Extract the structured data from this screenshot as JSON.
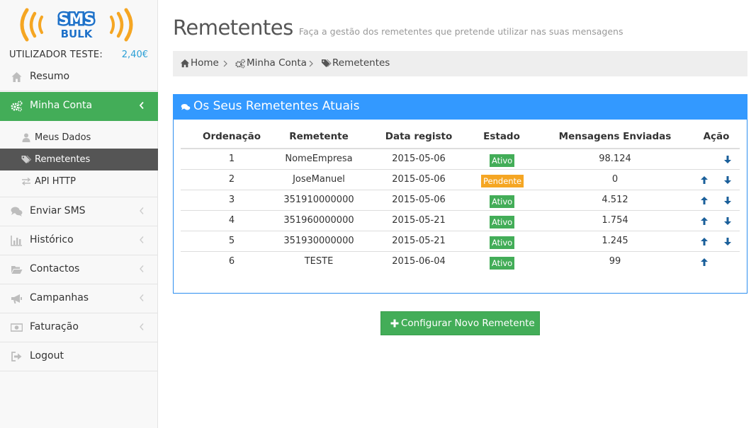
{
  "sidebar": {
    "logo": {
      "line1": "SMS",
      "line2": "BULK"
    },
    "user": {
      "name": "UTILIZADOR TESTE:",
      "balance": "2,40€"
    },
    "items": [
      {
        "label": "Resumo",
        "icon": "home-icon"
      },
      {
        "label": "Minha Conta",
        "icon": "cogs-icon",
        "active": true
      },
      {
        "label": "Enviar SMS",
        "icon": "comments-icon"
      },
      {
        "label": "Histórico",
        "icon": "bar-chart-icon"
      },
      {
        "label": "Contactos",
        "icon": "folder-open-icon"
      },
      {
        "label": "Campanhas",
        "icon": "bullhorn-icon"
      },
      {
        "label": "Faturação",
        "icon": "money-icon"
      },
      {
        "label": "Logout",
        "icon": "sign-out-icon"
      }
    ],
    "subitems": [
      {
        "label": "Meus Dados",
        "icon": "user-icon"
      },
      {
        "label": "Remetentes",
        "icon": "tags-icon",
        "active": true
      },
      {
        "label": "API HTTP",
        "icon": "exchange-icon"
      }
    ]
  },
  "header": {
    "title": "Remetentes",
    "subtitle": "Faça a gestão dos remetentes que pretende utilizar nas suas mensagens"
  },
  "breadcrumb": [
    "Home",
    "Minha Conta",
    "Remetentes"
  ],
  "panel": {
    "title": "Os Seus Remetentes Atuais",
    "columns": [
      "Ordenação",
      "Remetente",
      "Data registo",
      "Estado",
      "Mensagens Enviadas",
      "Ação"
    ],
    "rows": [
      {
        "ordem": "1",
        "remetente": "NomeEmpresa",
        "data": "2015-05-06",
        "estado": "Ativo",
        "mensagens": "98.124",
        "up": false,
        "down": true
      },
      {
        "ordem": "2",
        "remetente": "JoseManuel",
        "data": "2015-05-06",
        "estado": "Pendente",
        "mensagens": "0",
        "up": true,
        "down": true
      },
      {
        "ordem": "3",
        "remetente": "351910000000",
        "data": "2015-05-06",
        "estado": "Ativo",
        "mensagens": "4.512",
        "up": true,
        "down": true
      },
      {
        "ordem": "4",
        "remetente": "351960000000",
        "data": "2015-05-21",
        "estado": "Ativo",
        "mensagens": "1.754",
        "up": true,
        "down": true
      },
      {
        "ordem": "5",
        "remetente": "351930000000",
        "data": "2015-05-21",
        "estado": "Ativo",
        "mensagens": "1.245",
        "up": true,
        "down": true
      },
      {
        "ordem": "6",
        "remetente": "TESTE",
        "data": "2015-06-04",
        "estado": "Ativo",
        "mensagens": "99",
        "up": true,
        "down": false
      }
    ]
  },
  "actions": {
    "new_sender": "Configurar Novo Remetente"
  },
  "colors": {
    "accent_green": "#43ad58",
    "primary_blue": "#3399ff",
    "pending_orange": "#f5a623",
    "arrow_blue": "#1a5f9a",
    "balance_blue": "#2a9fd6"
  }
}
